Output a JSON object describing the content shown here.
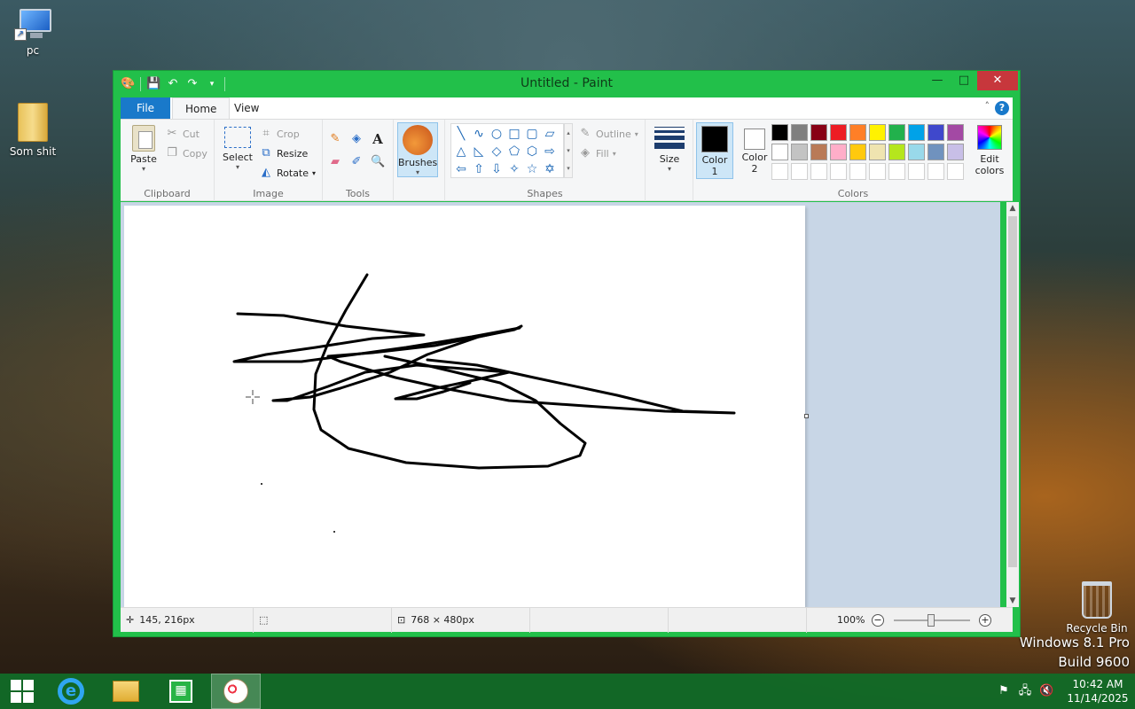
{
  "desktop": {
    "icons": [
      {
        "label": "pc"
      },
      {
        "label": "Som shit"
      },
      {
        "label": "Recycle Bin"
      }
    ],
    "watermark": {
      "line1": "Windows 8.1 Pro",
      "line2": "Build 9600"
    }
  },
  "window": {
    "title": "Untitled - Paint",
    "controls": {
      "minimize": "—",
      "maximize": "□",
      "close": "✕"
    },
    "tabs": [
      {
        "label": "File"
      },
      {
        "label": "Home"
      },
      {
        "label": "View"
      }
    ],
    "ribbon": {
      "clipboard": {
        "label": "Clipboard",
        "paste": "Paste",
        "cut": "Cut",
        "copy": "Copy"
      },
      "image": {
        "label": "Image",
        "select": "Select",
        "crop": "Crop",
        "resize": "Resize",
        "rotate": "Rotate"
      },
      "tools": {
        "label": "Tools"
      },
      "brushes": {
        "label": "Brushes"
      },
      "shapes": {
        "label": "Shapes",
        "outline": "Outline",
        "fill": "Fill"
      },
      "size": {
        "label": "Size"
      },
      "colors": {
        "label": "Colors",
        "color1_line1": "Color",
        "color1_line2": "1",
        "color2_line1": "Color",
        "color2_line2": "2",
        "edit_line1": "Edit",
        "edit_line2": "colors",
        "color1_value": "#000000",
        "color2_value": "#ffffff",
        "palette_row1": [
          "#000000",
          "#7f7f7f",
          "#880015",
          "#ed1c24",
          "#ff7f27",
          "#fff200",
          "#22b14c",
          "#00a2e8",
          "#3f48cc",
          "#a349a4"
        ],
        "palette_row2": [
          "#ffffff",
          "#c3c3c3",
          "#b97a57",
          "#ffaec9",
          "#ffc90e",
          "#efe4b0",
          "#b5e61d",
          "#99d9ea",
          "#7092be",
          "#c8bfe7"
        ]
      }
    },
    "status": {
      "cursor_pos": "145, 216px",
      "image_size": "768 × 480px",
      "zoom": "100%"
    }
  },
  "taskbar": {
    "time": "10:42 AM",
    "date": "11/14/2025"
  },
  "colors": {
    "window_frame": "#22c04a",
    "accent": "#1979ca"
  }
}
